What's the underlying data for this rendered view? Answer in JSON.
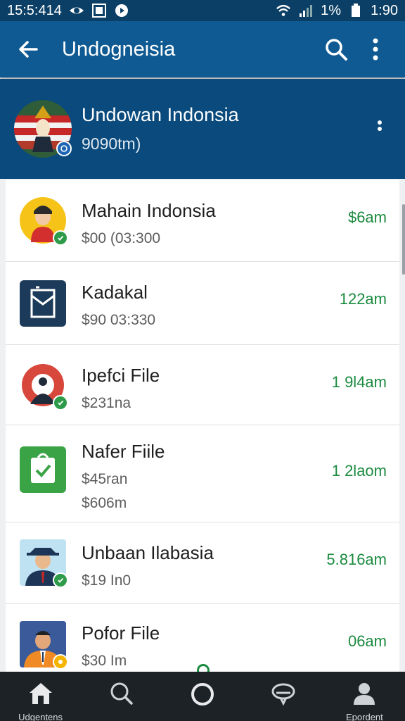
{
  "status_bar": {
    "time_left": "15:5:414",
    "battery": "1%",
    "time_right": "1:90"
  },
  "app_bar": {
    "title": "Undogneisia"
  },
  "profile": {
    "name": "Undowan Indonsia",
    "subtitle": "9090tm)"
  },
  "items": [
    {
      "title": "Mahain Indonsia",
      "meta": "$00 (03:300",
      "meta2": "",
      "time": "$6am"
    },
    {
      "title": "Kadakal",
      "meta": "$90 03:330",
      "meta2": "",
      "time": "122am"
    },
    {
      "title": "Ipefci File",
      "meta": "$231na",
      "meta2": "",
      "time": "1 9l4am"
    },
    {
      "title": "Nafer Fiile",
      "meta": "$45ran",
      "meta2": "$606m",
      "time": "1 2laom"
    },
    {
      "title": "Unbaan Ilabasia",
      "meta": "$19 In0",
      "meta2": "",
      "time": "5.816am"
    },
    {
      "title": "Pofor File",
      "meta": "$30 Im",
      "meta2": "",
      "time": "06am"
    }
  ],
  "bottom_nav": {
    "home_label": "Udgentens",
    "profile_label": "Epordent"
  },
  "colors": {
    "appbar": "#0f5a93",
    "header": "#0a4a7c",
    "accent_green": "#1b8a3f",
    "nav": "#1d2227"
  }
}
